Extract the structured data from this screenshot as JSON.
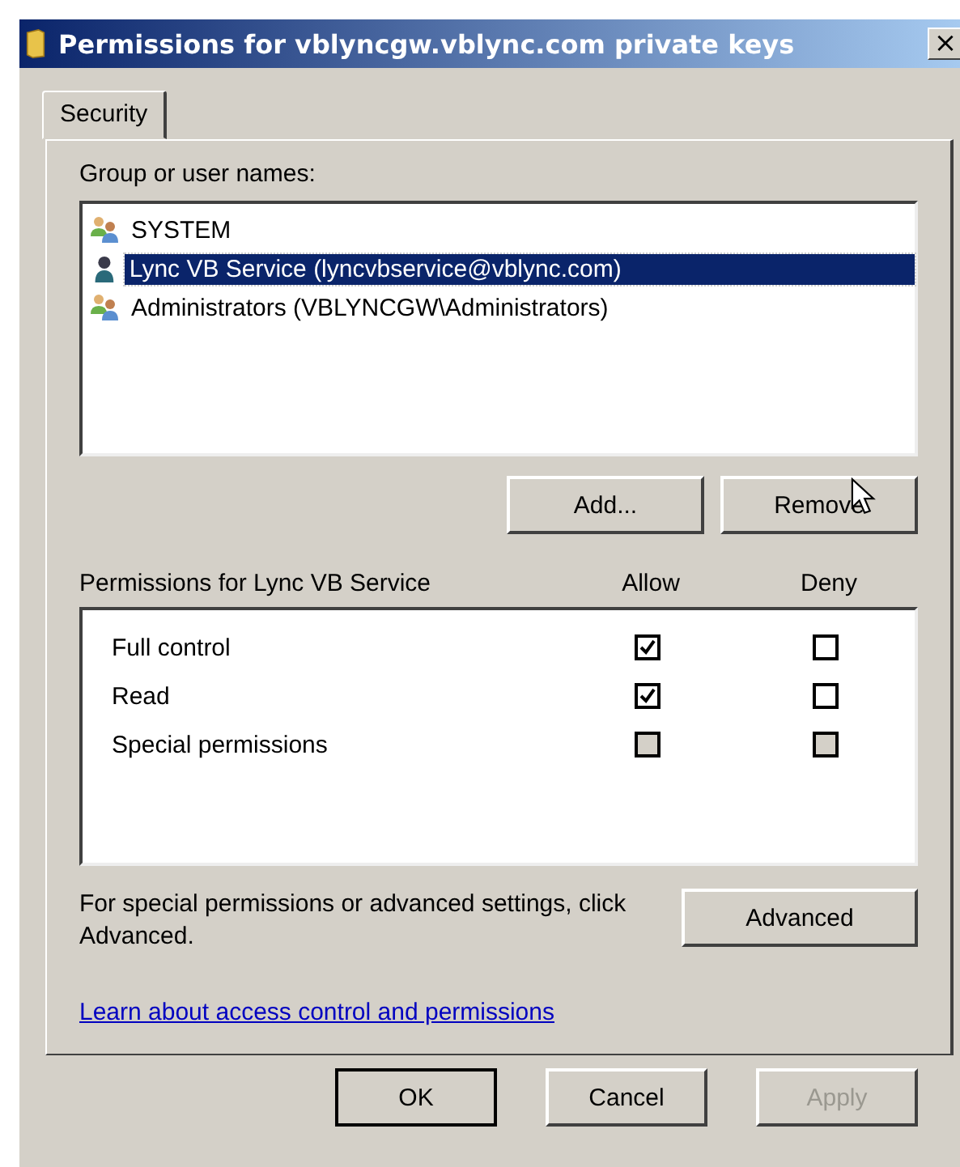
{
  "window": {
    "title": "Permissions for vblyncgw.vblync.com private keys",
    "close": "×"
  },
  "tabs": [
    {
      "label": "Security",
      "selected": true
    }
  ],
  "group_label": "Group or user names:",
  "principals": [
    {
      "name": "SYSTEM",
      "kind": "group",
      "selected": false
    },
    {
      "name": "Lync VB Service (lyncvbservice@vblync.com)",
      "kind": "user",
      "selected": true
    },
    {
      "name": "Administrators (VBLYNCGW\\Administrators)",
      "kind": "group",
      "selected": false
    }
  ],
  "principal_buttons": [
    {
      "label": "Add...",
      "disabled": false
    },
    {
      "label": "Remove",
      "disabled": false
    }
  ],
  "permissions_header": {
    "title": "Permissions for Lync VB Service",
    "allow": "Allow",
    "deny": "Deny"
  },
  "permissions": [
    {
      "name": "Full control",
      "allow": {
        "checked": true,
        "disabled": false
      },
      "deny": {
        "checked": false,
        "disabled": false
      }
    },
    {
      "name": "Read",
      "allow": {
        "checked": true,
        "disabled": false
      },
      "deny": {
        "checked": false,
        "disabled": false
      }
    },
    {
      "name": "Special permissions",
      "allow": {
        "checked": false,
        "disabled": true
      },
      "deny": {
        "checked": false,
        "disabled": true
      }
    }
  ],
  "advanced_note": "For special permissions or advanced settings, click Advanced.",
  "advanced_button": "Advanced",
  "help_link": "Learn about access control and permissions",
  "buttons": [
    {
      "label": "OK",
      "default": true,
      "disabled": false
    },
    {
      "label": "Cancel",
      "default": false,
      "disabled": false
    },
    {
      "label": "Apply",
      "default": false,
      "disabled": true
    }
  ]
}
